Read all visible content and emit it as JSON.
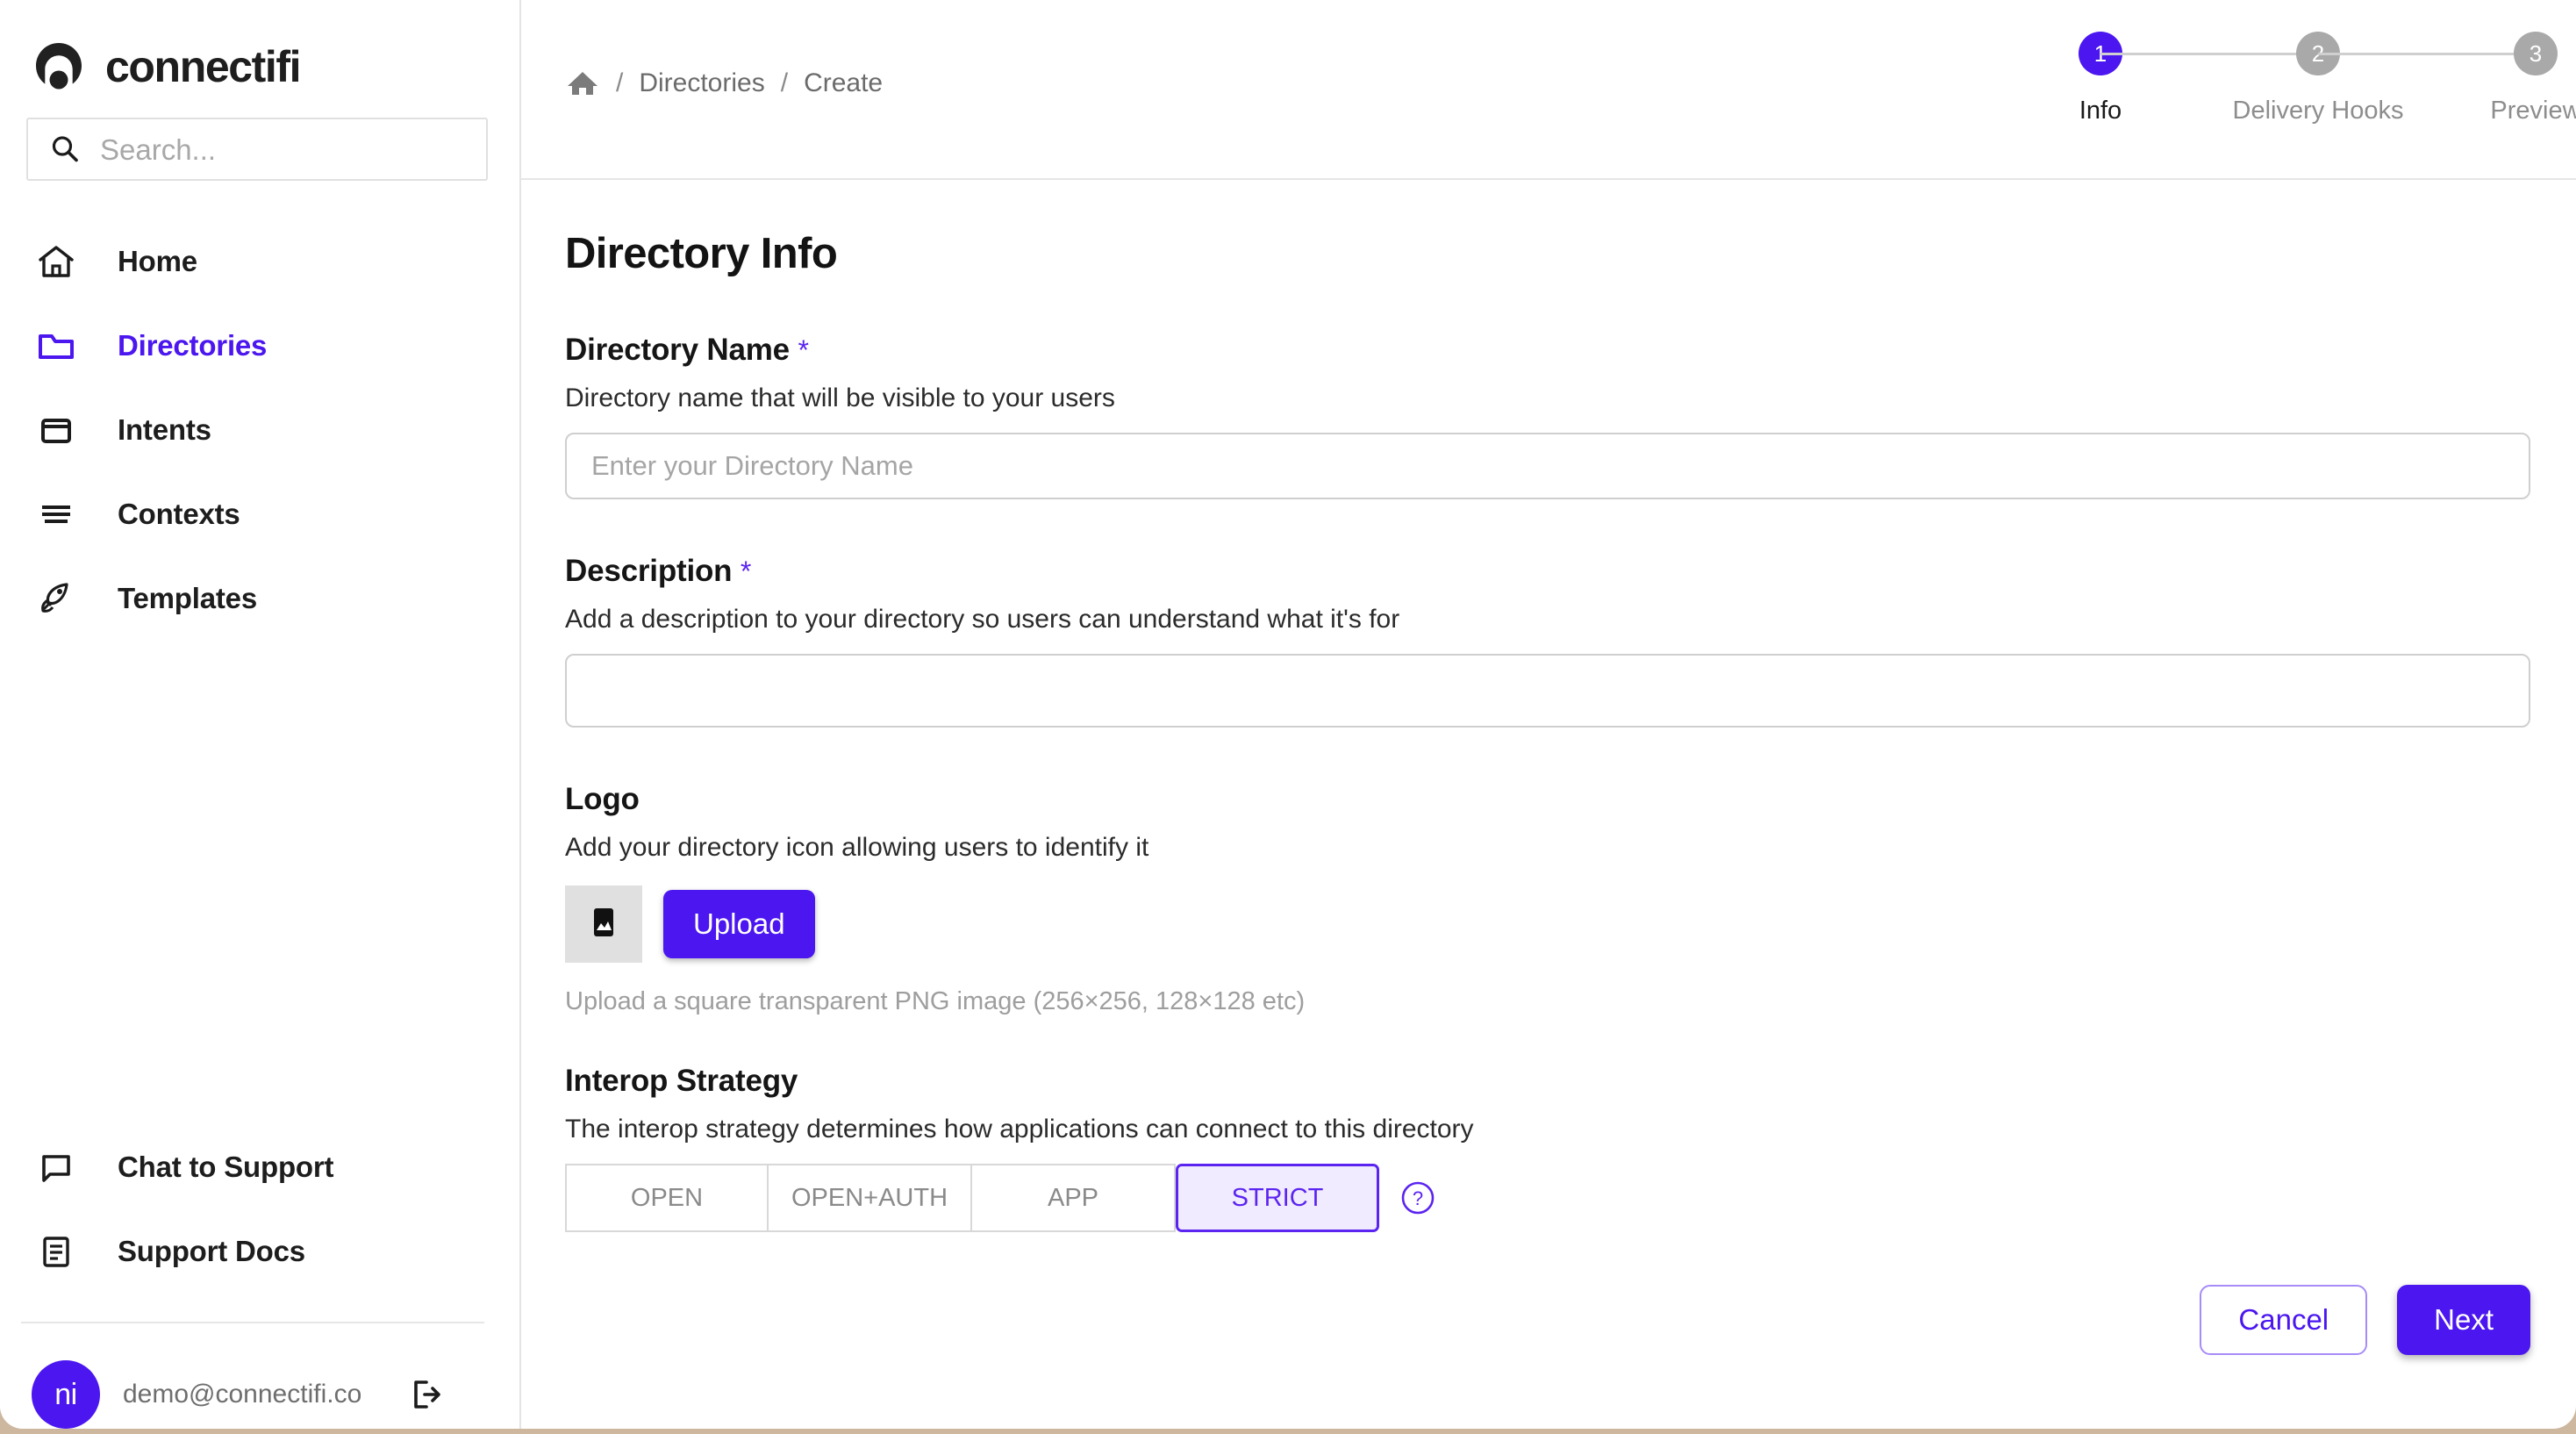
{
  "brand": {
    "name": "connectifi",
    "logo_icon": "connectifi-logo-icon"
  },
  "search": {
    "placeholder": "Search...",
    "value": "",
    "icon": "search-icon"
  },
  "sidebar": {
    "items": [
      {
        "label": "Home",
        "icon": "home-icon",
        "active": false
      },
      {
        "label": "Directories",
        "icon": "folder-icon",
        "active": true
      },
      {
        "label": "Intents",
        "icon": "window-icon",
        "active": false
      },
      {
        "label": "Contexts",
        "icon": "list-lines-icon",
        "active": false
      },
      {
        "label": "Templates",
        "icon": "rocket-icon",
        "active": false
      }
    ],
    "support_items": [
      {
        "label": "Chat to Support",
        "icon": "chat-bubble-icon"
      },
      {
        "label": "Support Docs",
        "icon": "document-icon"
      }
    ],
    "user": {
      "initials": "ni",
      "email": "demo@connectifi.co",
      "logout_icon": "logout-icon"
    }
  },
  "breadcrumb": {
    "home_icon": "home-icon",
    "separator": "/",
    "items": [
      "Directories",
      "Create"
    ]
  },
  "stepper": {
    "steps": [
      {
        "number": "1",
        "label": "Info",
        "active": true
      },
      {
        "number": "2",
        "label": "Delivery Hooks",
        "active": false
      },
      {
        "number": "3",
        "label": "Preview",
        "active": false
      }
    ]
  },
  "page": {
    "title": "Directory Info"
  },
  "form": {
    "directory_name": {
      "label": "Directory Name",
      "required_mark": "*",
      "help": "Directory name that will be visible to your users",
      "placeholder": "Enter your Directory Name",
      "value": ""
    },
    "description": {
      "label": "Description",
      "required_mark": "*",
      "help": "Add a description to your directory so users can understand what it's for",
      "placeholder": "",
      "value": ""
    },
    "logo": {
      "label": "Logo",
      "help": "Add your directory icon allowing users to identify it",
      "upload_label": "Upload",
      "hint": "Upload a square transparent PNG image (256×256, 128×128 etc)",
      "thumb_icon": "image-placeholder-icon"
    },
    "interop_strategy": {
      "label": "Interop Strategy",
      "help": "The interop strategy determines how applications can connect to this directory",
      "options": [
        "OPEN",
        "OPEN+AUTH",
        "APP",
        "STRICT"
      ],
      "selected": "STRICT",
      "help_icon": "question-mark-icon"
    }
  },
  "actions": {
    "cancel_label": "Cancel",
    "next_label": "Next"
  },
  "colors": {
    "accent": "#4b16ef",
    "accent_soft": "#f0ebfe",
    "muted_text": "#8a8a8a",
    "step_inactive": "#a9a9a9",
    "page_backdrop": "#cdb79e"
  }
}
